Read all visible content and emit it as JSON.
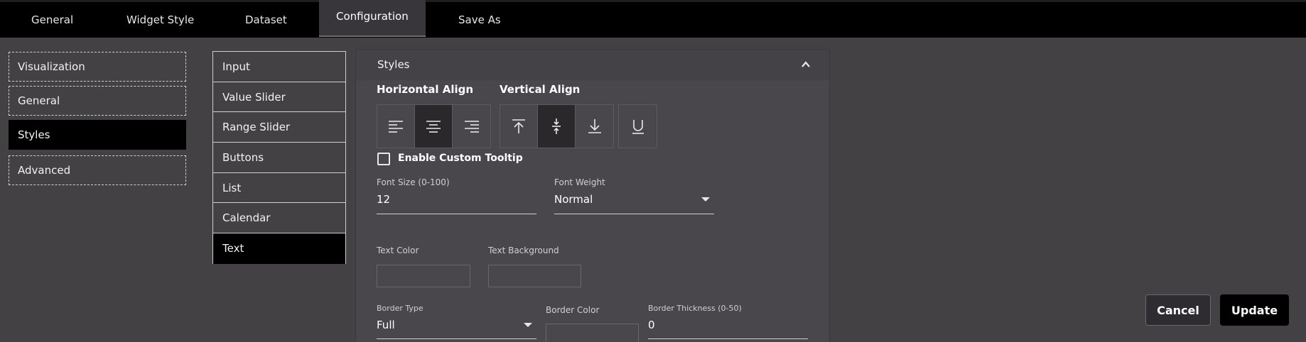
{
  "tabs": [
    {
      "label": "General"
    },
    {
      "label": "Widget Style"
    },
    {
      "label": "Dataset"
    },
    {
      "label": "Configuration",
      "active": true
    },
    {
      "label": "Save As"
    }
  ],
  "left_nav": [
    {
      "label": "Visualization"
    },
    {
      "label": "General"
    },
    {
      "label": "Styles",
      "active": true
    },
    {
      "label": "Advanced"
    }
  ],
  "widget_types": [
    {
      "label": "Input"
    },
    {
      "label": "Value Slider"
    },
    {
      "label": "Range Slider"
    },
    {
      "label": "Buttons"
    },
    {
      "label": "List"
    },
    {
      "label": "Calendar"
    },
    {
      "label": "Text",
      "active": true
    }
  ],
  "panel": {
    "title": "Styles",
    "horizontal_align": {
      "label": "Horizontal Align",
      "options": [
        "align-left-icon",
        "align-center-icon",
        "align-right-icon"
      ],
      "selected": "center"
    },
    "vertical_align": {
      "label": "Vertical Align",
      "options": [
        "align-top-icon",
        "align-middle-icon",
        "align-bottom-icon"
      ],
      "selected": "middle"
    },
    "underline_icon": "underline-icon",
    "custom_tooltip": {
      "label": "Enable Custom Tooltip",
      "checked": false
    },
    "font_size": {
      "label": "Font Size (0-100)",
      "value": "12"
    },
    "font_weight": {
      "label": "Font Weight",
      "value": "Normal"
    },
    "text_color": {
      "label": "Text Color"
    },
    "text_background": {
      "label": "Text Background"
    },
    "border_type": {
      "label": "Border Type",
      "value": "Full"
    },
    "border_color": {
      "label": "Border Color"
    },
    "border_thickness": {
      "label": "Border Thickness (0-50)",
      "value": "0"
    }
  },
  "actions": {
    "cancel": "Cancel",
    "update": "Update"
  }
}
